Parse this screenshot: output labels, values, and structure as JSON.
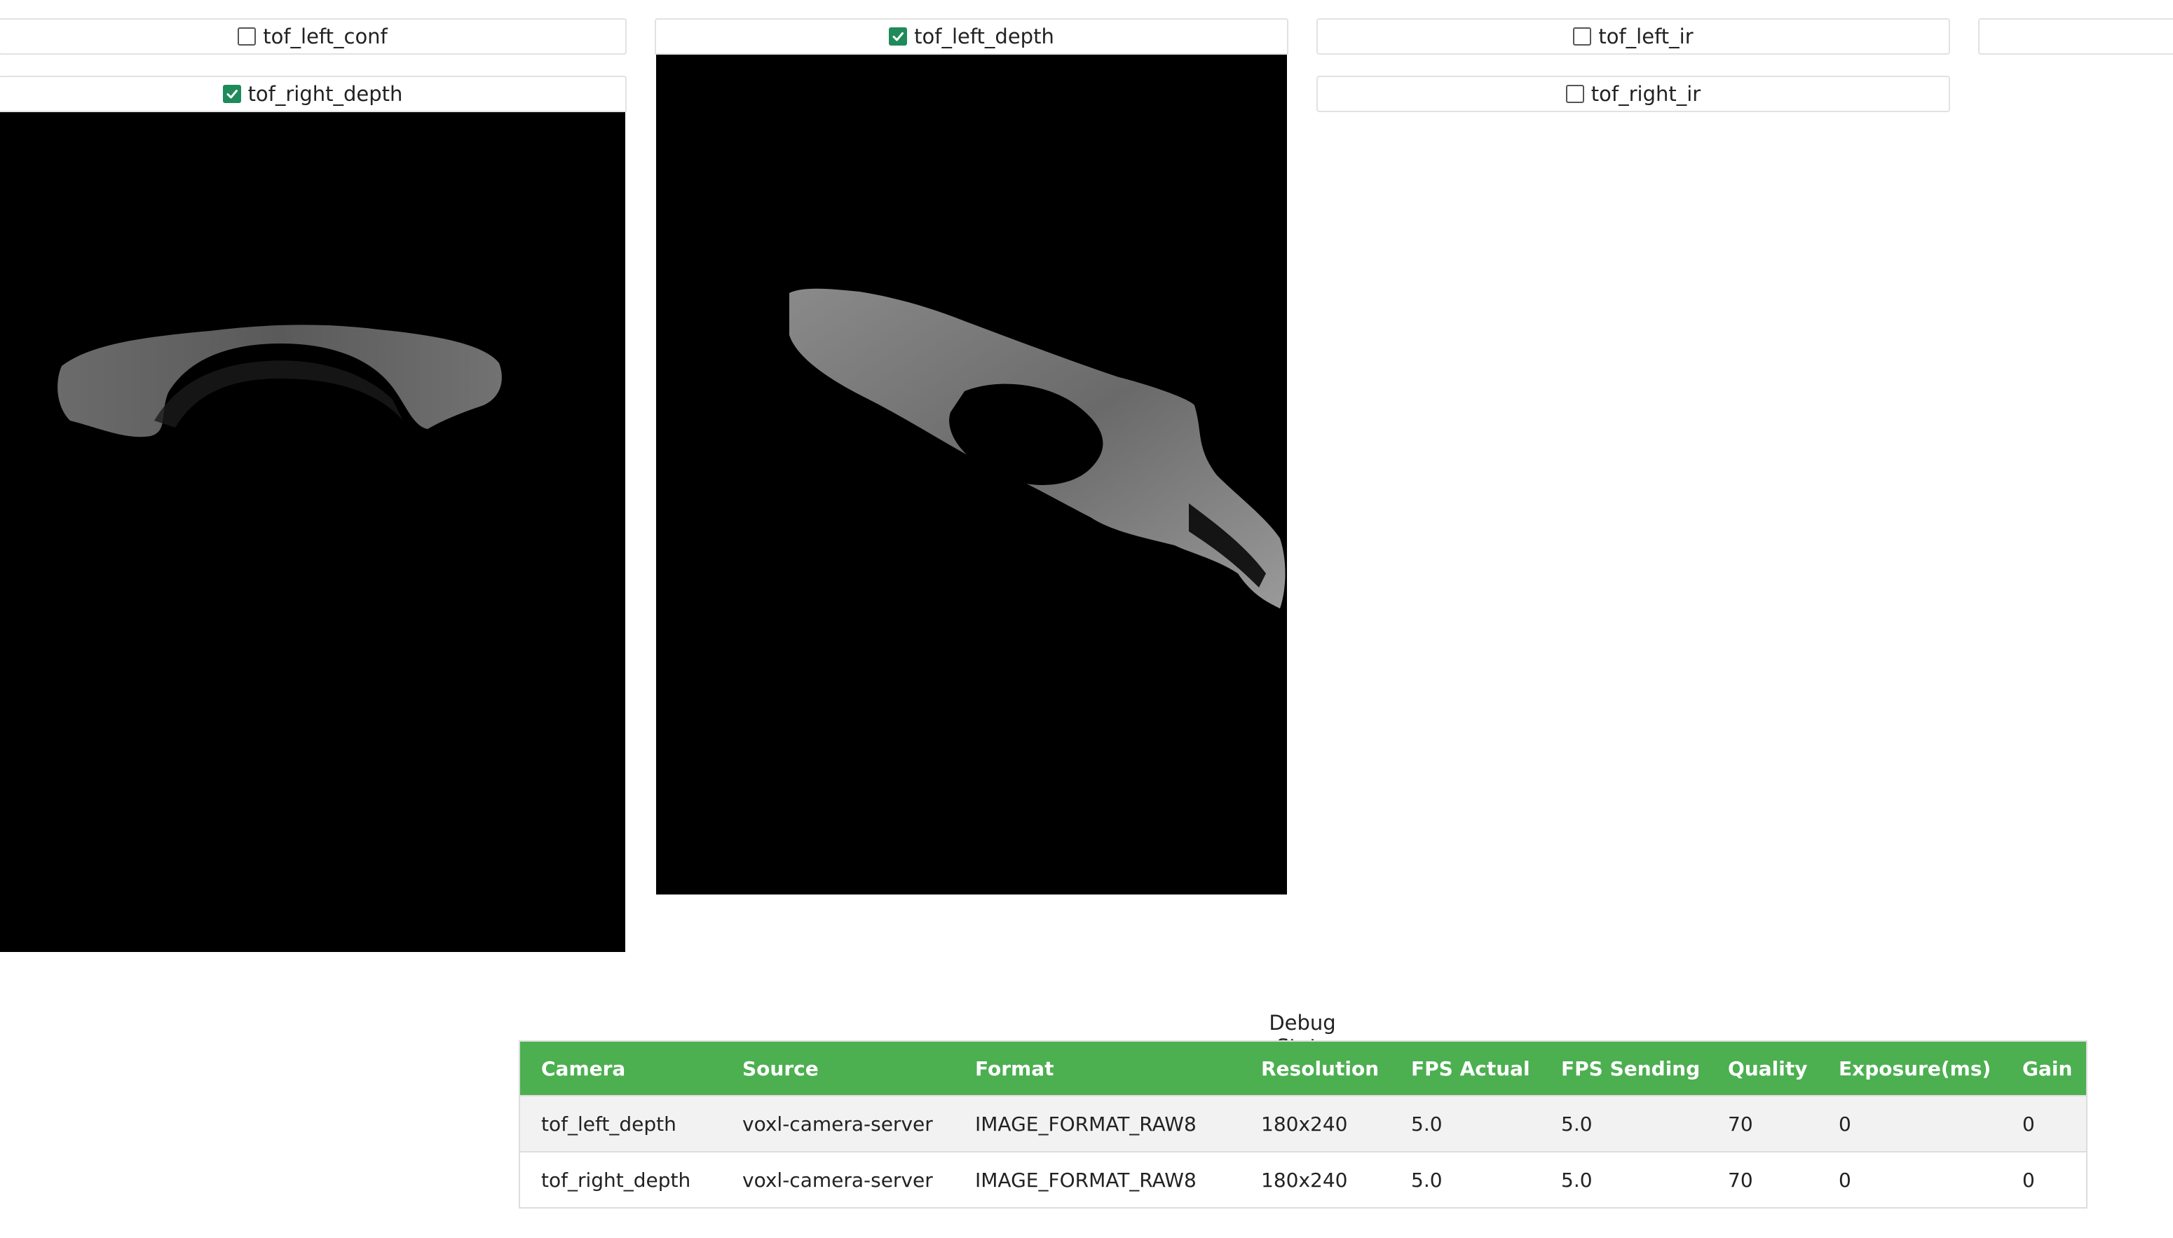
{
  "cameras": {
    "tof_left_conf": {
      "label": "tof_left_conf",
      "checked": false
    },
    "tof_left_depth": {
      "label": "tof_left_depth",
      "checked": true
    },
    "tof_left_ir": {
      "label": "tof_left_ir",
      "checked": false
    },
    "tof_right_depth": {
      "label": "tof_right_depth",
      "checked": true
    },
    "tof_right_ir": {
      "label": "tof_right_ir",
      "checked": false
    }
  },
  "debug_stats": {
    "title": "Debug Stats",
    "columns": [
      "Camera",
      "Source",
      "Format",
      "Resolution",
      "FPS Actual",
      "FPS Sending",
      "Quality",
      "Exposure(ms)",
      "Gain"
    ],
    "rows": [
      [
        "tof_left_depth",
        "voxl-camera-server",
        "IMAGE_FORMAT_RAW8",
        "180x240",
        "5.0",
        "5.0",
        "70",
        "0",
        "0"
      ],
      [
        "tof_right_depth",
        "voxl-camera-server",
        "IMAGE_FORMAT_RAW8",
        "180x240",
        "5.0",
        "5.0",
        "70",
        "0",
        "0"
      ]
    ]
  },
  "colors": {
    "checkbox_checked": "#1f8a5a",
    "table_header": "#4caf50",
    "camera_background": "#000000"
  }
}
